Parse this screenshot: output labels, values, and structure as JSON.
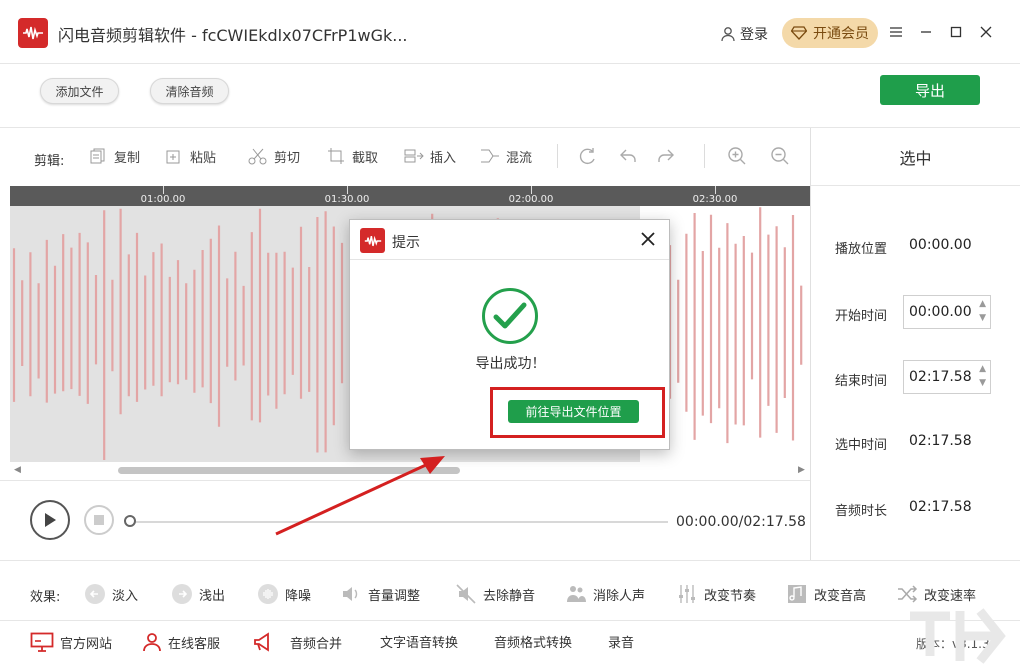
{
  "titlebar": {
    "title": "闪电音频剪辑软件 - fcCWIEkdlx07CFrP1wGk...",
    "login_label": "登录",
    "vip_label": "开通会员"
  },
  "toolbar": {
    "add_file": "添加文件",
    "clear_audio": "清除音频",
    "export": "导出"
  },
  "edit": {
    "label": "剪辑:",
    "copy": "复制",
    "paste": "粘贴",
    "cut": "剪切",
    "crop": "截取",
    "insert": "插入",
    "mix": "混流"
  },
  "ruler": {
    "ticks": [
      "01:00.00",
      "01:30.00",
      "02:00.00",
      "02:30.00"
    ]
  },
  "player": {
    "time": "00:00.00/02:17.58"
  },
  "panel": {
    "title": "选中",
    "play_pos_label": "播放位置",
    "play_pos_value": "00:00.00",
    "start_label": "开始时间",
    "start_value": "00:00.00",
    "end_label": "结束时间",
    "end_value": "02:17.58",
    "sel_label": "选中时间",
    "sel_value": "02:17.58",
    "dur_label": "音频时长",
    "dur_value": "02:17.58"
  },
  "effects": {
    "label": "效果:",
    "items": [
      "淡入",
      "浅出",
      "降噪",
      "音量调整",
      "去除静音",
      "消除人声",
      "改变节奏",
      "改变音高",
      "改变速率"
    ]
  },
  "bottom": {
    "website": "官方网站",
    "service": "在线客服",
    "merge": "音频合并",
    "tts": "文字语音转换",
    "format": "音频格式转换",
    "record": "录音",
    "version": "版本：v3.1.3"
  },
  "dialog": {
    "title": "提示",
    "message": "导出成功！",
    "button": "前往导出文件位置"
  },
  "colors": {
    "accent_green": "#1f9e4b",
    "brand_red": "#d42a2a",
    "waveform": "#e3a5a5",
    "vip_gold": "#f4d9a9"
  }
}
